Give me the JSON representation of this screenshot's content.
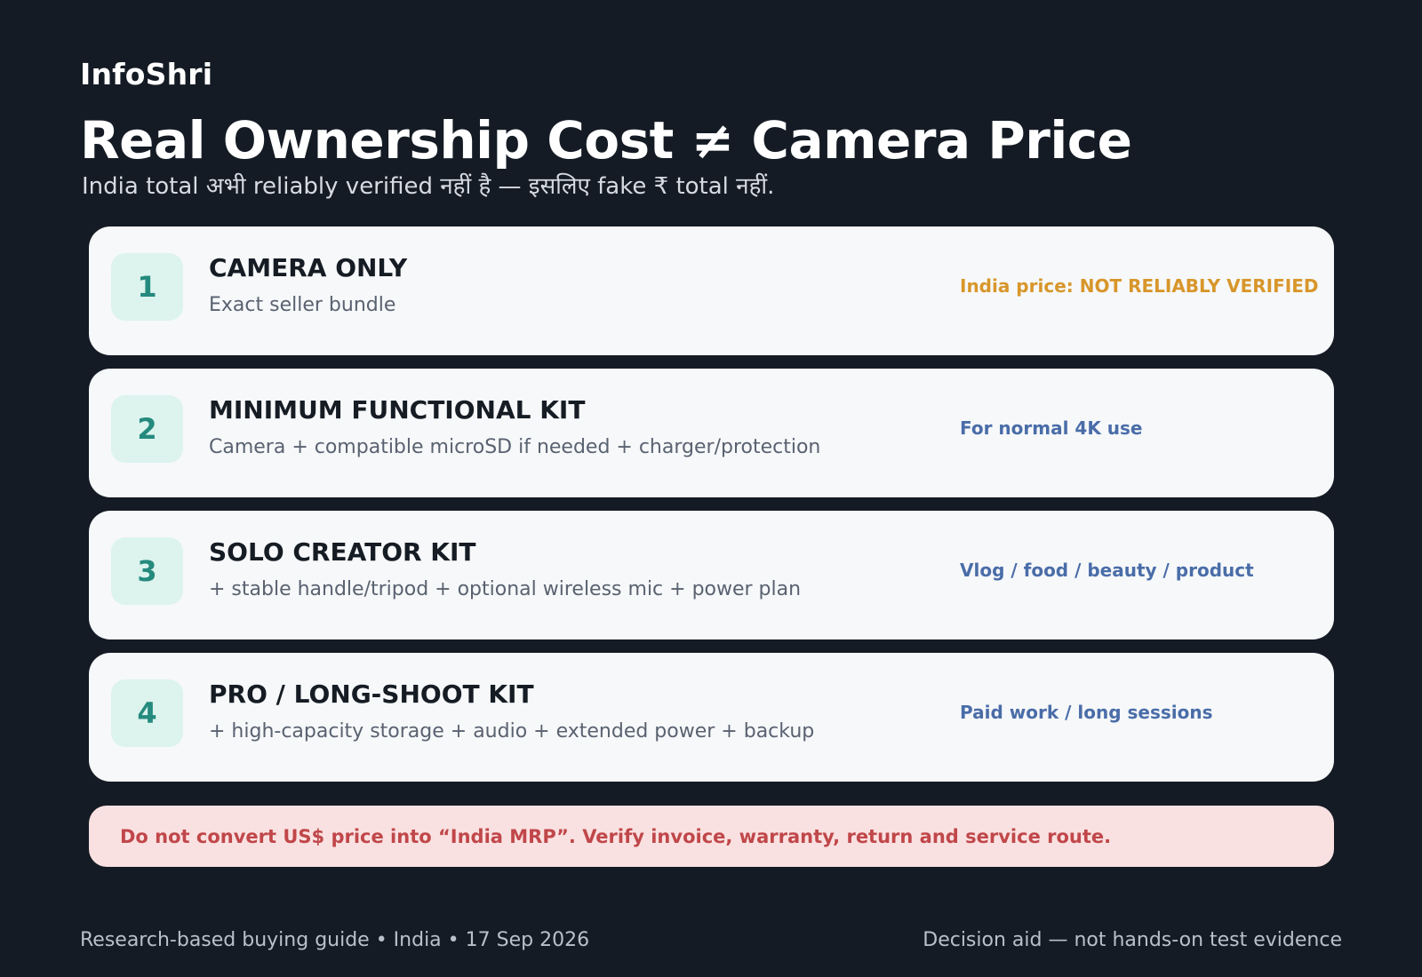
{
  "brand": "InfoShri",
  "title": "Real Ownership Cost ≠ Camera Price",
  "subtitle": "India total अभी reliably verified नहीं है — इसलिए fake ₹ total नहीं.",
  "cards": [
    {
      "number": "1",
      "title": "CAMERA ONLY",
      "desc": "Exact seller bundle",
      "note": "India price: NOT RELIABLY VERIFIED",
      "note_color": "#d8962a"
    },
    {
      "number": "2",
      "title": "MINIMUM FUNCTIONAL KIT",
      "desc": "Camera + compatible microSD if needed + charger/protection",
      "note": "For normal 4K use",
      "note_color": "#4a6da8"
    },
    {
      "number": "3",
      "title": "SOLO CREATOR KIT",
      "desc": "+ stable handle/tripod + optional wireless mic + power plan",
      "note": "Vlog / food / beauty / product",
      "note_color": "#4a6da8"
    },
    {
      "number": "4",
      "title": "PRO / LONG-SHOOT KIT",
      "desc": "+ high-capacity storage + audio + extended power + backup",
      "note": "Paid work / long sessions",
      "note_color": "#4a6da8"
    }
  ],
  "alert": "Do not convert US$ price into “India MRP”. Verify invoice, warranty, return and service route.",
  "footer": {
    "left": "Research-based buying guide • India • 17 Sep 2026",
    "right": "Decision aid — not hands-on test evidence"
  },
  "colors": {
    "background": "#141b24",
    "card": "#f6f8fa",
    "badge_bg": "#dcf3ee",
    "badge_text": "#258a7e",
    "alert_bg": "#fae1e1",
    "alert_text": "#c0474a"
  }
}
